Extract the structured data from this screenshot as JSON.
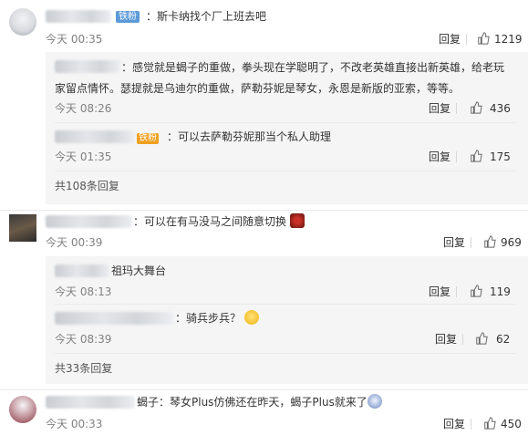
{
  "comments": [
    {
      "badge": "铁粉",
      "text": "：斯卡纳找个厂上班去吧",
      "time": "今天 00:35",
      "reply_label": "回复",
      "likes": "1219",
      "replies": [
        {
          "text_line1": "：感觉就是蝎子的重做，拳头现在学聪明了，不改老英雄直接出新英雄，给老玩",
          "text_line2": "家留点情怀。瑟提就是乌迪尔的重做，萨勒芬妮是琴女，永恩是新版的亚索，等等。",
          "time": "今天 08:26",
          "reply_label": "回复",
          "likes": "436"
        },
        {
          "badge": "铁粉",
          "text": "：可以去萨勒芬妮那当个私人助理",
          "time": "今天 01:35",
          "reply_label": "回复",
          "likes": "175"
        }
      ],
      "more": "共108条回复"
    },
    {
      "text": "：可以在有马没马之间随意切换",
      "time": "今天 00:39",
      "reply_label": "回复",
      "likes": "969",
      "replies": [
        {
          "text": "祖玛大舞台",
          "time": "今天 08:13",
          "reply_label": "回复",
          "likes": "119"
        },
        {
          "text": "：骑兵步兵？",
          "time": "今天 08:39",
          "reply_label": "回复",
          "likes": "62"
        }
      ],
      "more": "共33条回复"
    },
    {
      "text": "蝎子：琴女Plus仿佛还在昨天，蝎子Plus就来了",
      "time": "今天 00:33",
      "reply_label": "回复",
      "likes": "450"
    }
  ],
  "icons": {
    "like": "thumbs-up-icon",
    "emoji": "emoji-icon"
  }
}
